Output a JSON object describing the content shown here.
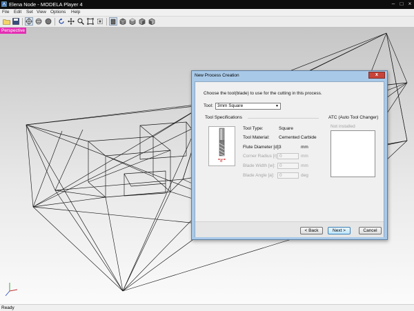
{
  "window": {
    "title": "Elena Node - MODELA Player 4"
  },
  "menu": [
    "File",
    "Edit",
    "Set",
    "View",
    "Options",
    "Help"
  ],
  "toolbar_icons": [
    "open-folder-icon",
    "save-icon",
    "view-all-icon",
    "sphere-view-icon",
    "rotate-view-icon",
    "rotate-icon",
    "pan-icon",
    "zoom-icon",
    "fit-icon",
    "fit-selection-icon",
    "front-view-icon",
    "side-view-icon",
    "top-view-icon",
    "iso-view-icon",
    "back-view-icon"
  ],
  "viewport": {
    "mode_label": "Perspective"
  },
  "status": {
    "text": "Ready"
  },
  "dialog": {
    "title": "New Process Creation",
    "close_label": "x",
    "instruction": "Choose the tool(blade) to use for the cutting in this process.",
    "tool_label": "Tool:",
    "tool_value": "3mm Square",
    "spec_heading": "Tool Specifications",
    "atc_heading": "ATC (Auto Tool Changer)",
    "atc_status": "Not installed",
    "specs": {
      "type_label": "Tool Type:",
      "type_value": "Square",
      "material_label": "Tool Material:",
      "material_value": "Cemented Carbide",
      "flute_label": "Flute Diameter [d]:",
      "flute_value": "3",
      "flute_unit": "mm",
      "corner_label": "Corner Radius [r]:",
      "corner_value": "0",
      "corner_unit": "mm",
      "blade_width_label": "Blade Width [w]:",
      "blade_width_value": "0",
      "blade_width_unit": "mm",
      "blade_angle_label": "Blade Angle [a]:",
      "blade_angle_value": "0",
      "blade_angle_unit": "deg"
    },
    "diagram_label": "d",
    "buttons": {
      "back": "< Back",
      "next": "Next >",
      "cancel": "Cancel"
    }
  },
  "colors": {
    "perspective_badge": "#e42fb4",
    "dialog_frame": "#a9c9e8",
    "close_button": "#c7443a",
    "titlebar": "#0d0d0d"
  }
}
